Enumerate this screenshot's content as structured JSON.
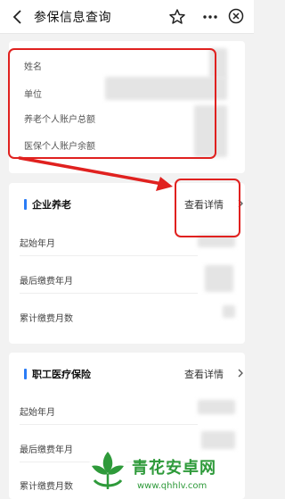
{
  "topbar": {
    "title": "参保信息查询"
  },
  "info": {
    "name_label": "姓名",
    "unit_label": "单位",
    "pension_total_label": "养老个人账户总额",
    "medical_balance_label": "医保个人账户余额"
  },
  "pension": {
    "title": "企业养老",
    "detail_label": "查看详情",
    "rows": [
      "起始年月",
      "最后缴费年月",
      "累计缴费月数"
    ]
  },
  "medical": {
    "title": "职工医疗保险",
    "detail_label": "查看详情",
    "rows": [
      "起始年月",
      "最后缴费年月",
      "累计缴费月数"
    ]
  },
  "watermark": {
    "title": "青花安卓网",
    "url": "www.qhhlv.com"
  },
  "colors": {
    "accent_blue": "#2a7cf6",
    "annotation_red": "#e0211f",
    "watermark_green": "#2e9a3a"
  },
  "icons": [
    "back-icon",
    "star-icon",
    "more-icon",
    "close-icon",
    "chevron-right-icon",
    "arrow-annotation"
  ]
}
